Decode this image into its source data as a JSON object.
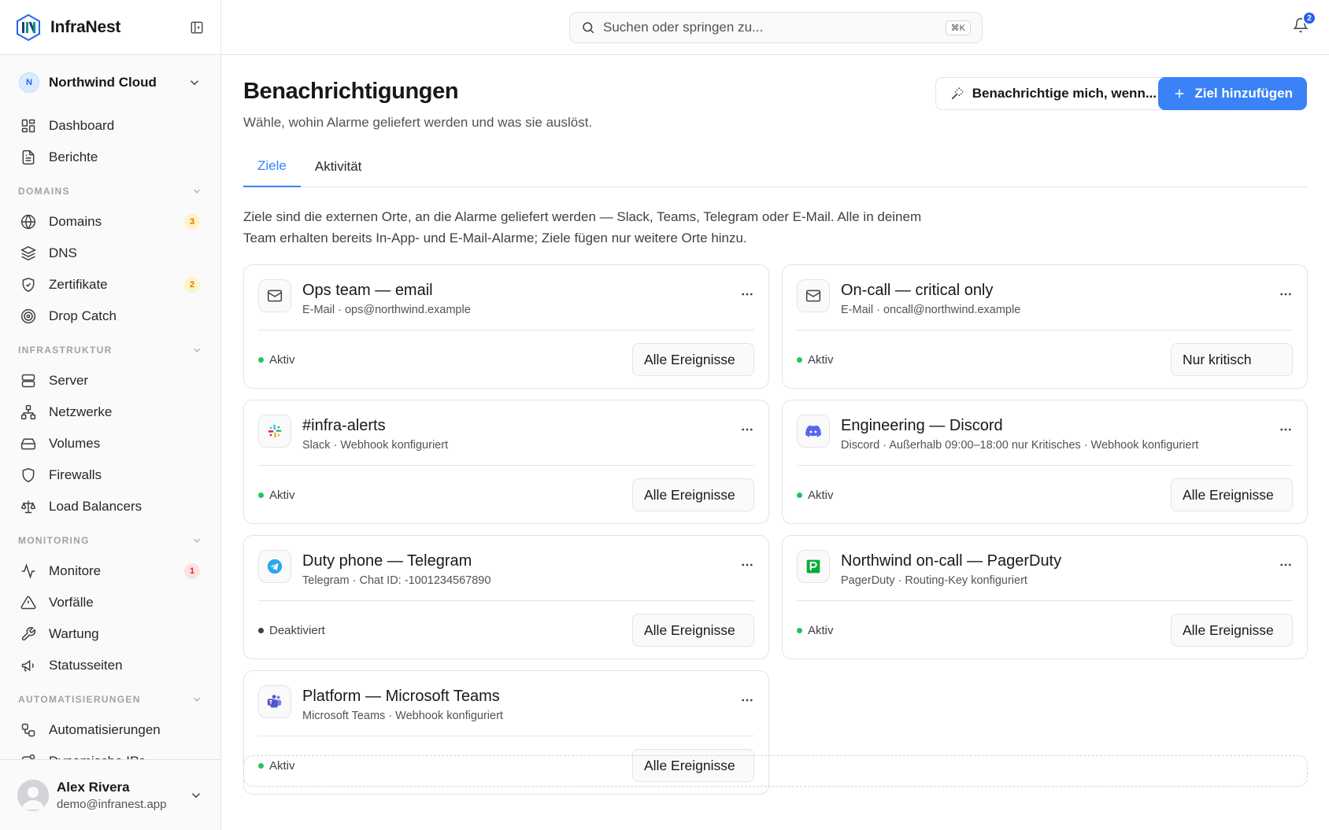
{
  "brand": {
    "name": "InfraNest"
  },
  "workspace": {
    "initial": "N",
    "name": "Northwind Cloud"
  },
  "nav": {
    "top": [
      {
        "label": "Dashboard",
        "icon": "dashboard-icon"
      },
      {
        "label": "Berichte",
        "icon": "report-icon"
      }
    ],
    "sections": [
      {
        "title": "DOMAINS",
        "items": [
          {
            "label": "Domains",
            "icon": "globe-icon",
            "badge": "3",
            "badge_color": "amber"
          },
          {
            "label": "DNS",
            "icon": "layers-icon"
          },
          {
            "label": "Zertifikate",
            "icon": "shield-check-icon",
            "badge": "2",
            "badge_color": "amber"
          },
          {
            "label": "Drop Catch",
            "icon": "target-icon"
          }
        ]
      },
      {
        "title": "INFRASTRUKTUR",
        "items": [
          {
            "label": "Server",
            "icon": "server-icon"
          },
          {
            "label": "Netzwerke",
            "icon": "network-icon"
          },
          {
            "label": "Volumes",
            "icon": "hard-drive-icon"
          },
          {
            "label": "Firewalls",
            "icon": "shield-icon"
          },
          {
            "label": "Load Balancers",
            "icon": "scale-icon"
          }
        ]
      },
      {
        "title": "MONITORING",
        "items": [
          {
            "label": "Monitore",
            "icon": "activity-icon",
            "badge": "1",
            "badge_color": "red"
          },
          {
            "label": "Vorfälle",
            "icon": "alert-triangle-icon"
          },
          {
            "label": "Wartung",
            "icon": "wrench-icon"
          },
          {
            "label": "Statusseiten",
            "icon": "megaphone-icon"
          }
        ]
      },
      {
        "title": "AUTOMATISIERUNGEN",
        "items": [
          {
            "label": "Automatisierungen",
            "icon": "workflow-icon"
          },
          {
            "label": "Dynamische IPs",
            "icon": "route-icon"
          }
        ]
      }
    ]
  },
  "user": {
    "name": "Alex Rivera",
    "email": "demo@infranest.app"
  },
  "search": {
    "placeholder": "Suchen oder springen zu...",
    "shortcut": "⌘K"
  },
  "notifications": {
    "count": "2"
  },
  "page": {
    "title": "Benachrichtigungen",
    "subtitle": "Wähle, wohin Alarme geliefert werden und was sie auslöst.",
    "notify_button": "Benachrichtige mich, wenn...",
    "add_button": "Ziel hinzufügen",
    "tabs": [
      "Ziele",
      "Aktivität"
    ],
    "intro": "Ziele sind die externen Orte, an die Alarme geliefert werden — Slack, Teams, Telegram oder E-Mail. Alle in deinem Team erhalten bereits In-App- und E-Mail-Alarme; Ziele fügen nur weitere Orte hinzu."
  },
  "destinations": [
    {
      "title": "Ops team — email",
      "subtitle": "E-Mail · ops@northwind.example",
      "icon": "mail-icon",
      "status": "Aktiv",
      "active": true,
      "filter": "Alle Ereignisse"
    },
    {
      "title": "On-call — critical only",
      "subtitle": "E-Mail · oncall@northwind.example",
      "icon": "mail-icon",
      "status": "Aktiv",
      "active": true,
      "filter": "Nur kritisch"
    },
    {
      "title": "#infra-alerts",
      "subtitle": "Slack · Webhook konfiguriert",
      "icon": "slack-icon",
      "status": "Aktiv",
      "active": true,
      "filter": "Alle Ereignisse"
    },
    {
      "title": "Engineering — Discord",
      "subtitle": "Discord · Außerhalb 09:00–18:00 nur Kritisches · Webhook konfiguriert",
      "icon": "discord-icon",
      "status": "Aktiv",
      "active": true,
      "filter": "Alle Ereignisse"
    },
    {
      "title": "Duty phone — Telegram",
      "subtitle": "Telegram · Chat ID: -1001234567890",
      "icon": "telegram-icon",
      "status": "Deaktiviert",
      "active": false,
      "filter": "Alle Ereignisse"
    },
    {
      "title": "Northwind on-call — PagerDuty",
      "subtitle": "PagerDuty · Routing-Key konfiguriert",
      "icon": "pagerduty-icon",
      "status": "Aktiv",
      "active": true,
      "filter": "Alle Ereignisse"
    },
    {
      "title": "Platform — Microsoft Teams",
      "subtitle": "Microsoft Teams · Webhook konfiguriert",
      "icon": "teams-icon",
      "status": "Aktiv",
      "active": true,
      "filter": "Alle Ereignisse"
    }
  ],
  "colors": {
    "accent": "#3b82f6",
    "active": "#22c55e",
    "badge_amber": "#d97706",
    "badge_red": "#dc2626"
  }
}
